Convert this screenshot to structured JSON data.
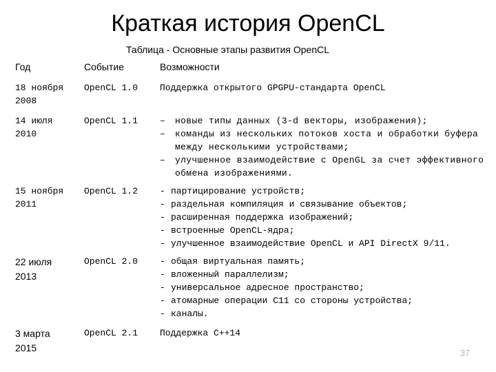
{
  "slide": {
    "title": "Краткая история OpenCL",
    "caption": "Таблица  - Основные этапы развития OpenCL",
    "number": "37",
    "number_color": "#b8b8b8",
    "background_color": "#ffffff",
    "text_color": "#000000"
  },
  "table": {
    "headers": {
      "year": "Год",
      "event": "Событие",
      "features": "Возможности"
    },
    "rows": [
      {
        "year": "18 ноября\n2008",
        "event": "OpenCL 1.0",
        "features_text": "Поддержка открытого GPGPU-стандарта OpenCL",
        "bullets": [],
        "bullet_char": ""
      },
      {
        "year": "14 июля\n2010",
        "event": "OpenCL 1.1",
        "features_text": "",
        "bullet_char": "–",
        "bullets": [
          "новые типы данных (3-d векторы, изображения);",
          "команды из нескольких потоков хоста и обработки буфера между несколькими устройствами;",
          "улучшенное взаимодействие с OpenGL за счет эффективного обмена изображениями."
        ]
      },
      {
        "year": "15 ноября\n2011",
        "event": "OpenCL 1.2",
        "features_text": "",
        "bullet_char": "-",
        "bullets": [
          "партицирование устройств;",
          "раздельная компиляция и связывание объектов;",
          "расширенная поддержка изображений;",
          "встроенные OpenCL-ядра;",
          "улучшенное взаимодействие OpenCL и API DirectX 9/11."
        ]
      },
      {
        "year": "22 июля\n2013",
        "event": "OpenCL 2.0",
        "features_text": "",
        "bullet_char": "-",
        "bullets": [
          "общая виртуальная память;",
          "вложенный параллелизм;",
          "универсальное адресное пространство;",
          "атомарные операции C11 со стороны устройства;",
          "каналы."
        ]
      },
      {
        "year": "3 марта\n2015",
        "event": "OpenCL 2.1",
        "features_text": "Поддержка C++14",
        "bullets": [],
        "bullet_char": ""
      }
    ]
  }
}
